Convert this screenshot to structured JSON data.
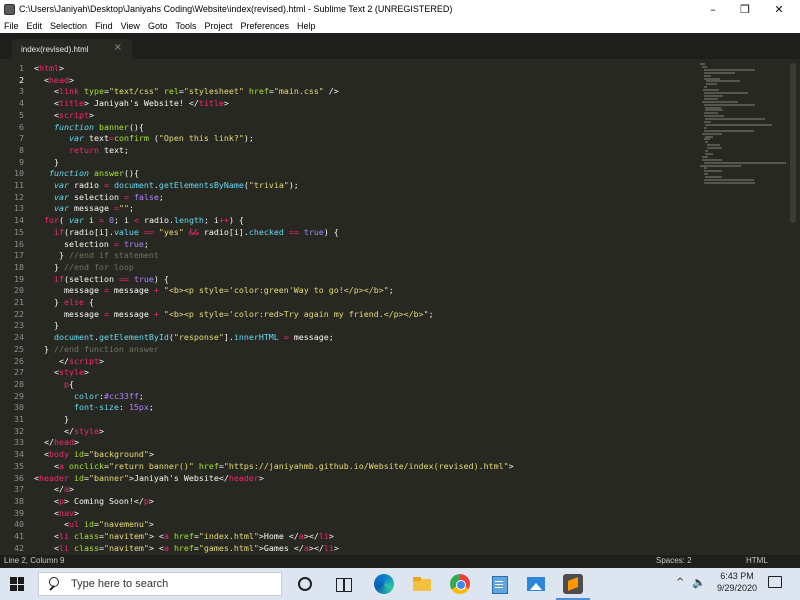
{
  "window": {
    "title": "C:\\Users\\Janiyah\\Desktop\\Janiyahs Coding\\Website\\index(revised).html - Sublime Text 2 (UNREGISTERED)",
    "minimize_glyph": "–",
    "maximize_glyph": "❐",
    "close_glyph": "✕"
  },
  "menu": [
    "File",
    "Edit",
    "Selection",
    "Find",
    "View",
    "Goto",
    "Tools",
    "Project",
    "Preferences",
    "Help"
  ],
  "tabs": [
    {
      "label": "index(revised).html",
      "close_glyph": "×"
    }
  ],
  "editor": {
    "active_line": 2,
    "line_numbers": [
      "1",
      "2",
      "3",
      "4",
      "5",
      "6",
      "7",
      "8",
      "9",
      "10",
      "11",
      "12",
      "13",
      "14",
      "15",
      "16",
      "17",
      "18",
      "19",
      "20",
      "21",
      "22",
      "23",
      "24",
      "25",
      "26",
      "27",
      "28",
      "29",
      "30",
      "31",
      "32",
      "33",
      "34",
      "35",
      "36",
      "37",
      "38",
      "39",
      "40",
      "41",
      "42"
    ],
    "lines": [
      [
        [
          "txt",
          "<"
        ],
        [
          "tag",
          "html"
        ],
        [
          "txt",
          ">"
        ]
      ],
      [
        [
          "txt",
          "  <"
        ],
        [
          "tag",
          "head"
        ],
        [
          "txt",
          ">"
        ]
      ],
      [
        [
          "txt",
          "    <"
        ],
        [
          "tag",
          "link"
        ],
        [
          "txt",
          " "
        ],
        [
          "attr",
          "type"
        ],
        [
          "txt",
          "="
        ],
        [
          "str",
          "\"text/css\""
        ],
        [
          "txt",
          " "
        ],
        [
          "attr",
          "rel"
        ],
        [
          "txt",
          "="
        ],
        [
          "str",
          "\"stylesheet\""
        ],
        [
          "txt",
          " "
        ],
        [
          "attr",
          "href"
        ],
        [
          "txt",
          "="
        ],
        [
          "str",
          "\"main.css\""
        ],
        [
          "txt",
          " />"
        ]
      ],
      [
        [
          "txt",
          "    <"
        ],
        [
          "tag",
          "title"
        ],
        [
          "txt",
          "> Janiyah's Website! </"
        ],
        [
          "tag",
          "title"
        ],
        [
          "txt",
          ">"
        ]
      ],
      [
        [
          "txt",
          "    <"
        ],
        [
          "tag",
          "script"
        ],
        [
          "txt",
          ">"
        ]
      ],
      [
        [
          "txt",
          "    "
        ],
        [
          "kw",
          "function"
        ],
        [
          "txt",
          " "
        ],
        [
          "fn",
          "banner"
        ],
        [
          "txt",
          "(){"
        ]
      ],
      [
        [
          "txt",
          "       "
        ],
        [
          "kw",
          "var"
        ],
        [
          "txt",
          " text"
        ],
        [
          "kwp",
          "="
        ],
        [
          "fn",
          "confirm"
        ],
        [
          "txt",
          " ("
        ],
        [
          "str",
          "\"Open this link?\""
        ],
        [
          "txt",
          ");"
        ]
      ],
      [
        [
          "txt",
          "       "
        ],
        [
          "kwp",
          "return"
        ],
        [
          "txt",
          " text;"
        ]
      ],
      [
        [
          "txt",
          "    }"
        ]
      ],
      [
        [
          "txt",
          "   "
        ],
        [
          "kw",
          "function"
        ],
        [
          "txt",
          " "
        ],
        [
          "fn",
          "answer"
        ],
        [
          "txt",
          "(){"
        ]
      ],
      [
        [
          "txt",
          "    "
        ],
        [
          "kw",
          "var"
        ],
        [
          "txt",
          " radio "
        ],
        [
          "kwp",
          "="
        ],
        [
          "txt",
          " "
        ],
        [
          "prop",
          "document"
        ],
        [
          "txt",
          "."
        ],
        [
          "prop",
          "getElementsByName"
        ],
        [
          "txt",
          "("
        ],
        [
          "str",
          "\"trivia\""
        ],
        [
          "txt",
          ");"
        ]
      ],
      [
        [
          "txt",
          "    "
        ],
        [
          "kw",
          "var"
        ],
        [
          "txt",
          " selection "
        ],
        [
          "kwp",
          "="
        ],
        [
          "txt",
          " "
        ],
        [
          "num",
          "false"
        ],
        [
          "txt",
          ";"
        ]
      ],
      [
        [
          "txt",
          "    "
        ],
        [
          "kw",
          "var"
        ],
        [
          "txt",
          " message "
        ],
        [
          "kwp",
          "="
        ],
        [
          "str",
          "\"\""
        ],
        [
          "txt",
          ";"
        ]
      ],
      [
        [
          "txt",
          "  "
        ],
        [
          "kwp",
          "for"
        ],
        [
          "txt",
          "( "
        ],
        [
          "kw",
          "var"
        ],
        [
          "txt",
          " i "
        ],
        [
          "kwp",
          "="
        ],
        [
          "txt",
          " "
        ],
        [
          "num",
          "0"
        ],
        [
          "txt",
          "; i "
        ],
        [
          "kwp",
          "<"
        ],
        [
          "txt",
          " radio."
        ],
        [
          "prop",
          "length"
        ],
        [
          "txt",
          "; i"
        ],
        [
          "kwp",
          "++"
        ],
        [
          "txt",
          ") {"
        ]
      ],
      [
        [
          "txt",
          "    "
        ],
        [
          "kwp",
          "if"
        ],
        [
          "txt",
          "(radio[i]."
        ],
        [
          "prop",
          "value"
        ],
        [
          "txt",
          " "
        ],
        [
          "kwp",
          "=="
        ],
        [
          "txt",
          " "
        ],
        [
          "str",
          "\"yes\""
        ],
        [
          "txt",
          " "
        ],
        [
          "kwp",
          "&&"
        ],
        [
          "txt",
          " radio[i]."
        ],
        [
          "prop",
          "checked"
        ],
        [
          "txt",
          " "
        ],
        [
          "kwp",
          "=="
        ],
        [
          "txt",
          " "
        ],
        [
          "num",
          "true"
        ],
        [
          "txt",
          ") {"
        ]
      ],
      [
        [
          "txt",
          "      selection "
        ],
        [
          "kwp",
          "="
        ],
        [
          "txt",
          " "
        ],
        [
          "num",
          "true"
        ],
        [
          "txt",
          ";"
        ]
      ],
      [
        [
          "txt",
          "     } "
        ],
        [
          "cm",
          "//end if statement"
        ]
      ],
      [
        [
          "txt",
          "    } "
        ],
        [
          "cm",
          "//end for loop"
        ]
      ],
      [
        [
          "txt",
          "    "
        ],
        [
          "kwp",
          "if"
        ],
        [
          "txt",
          "(selection "
        ],
        [
          "kwp",
          "=="
        ],
        [
          "txt",
          " "
        ],
        [
          "num",
          "true"
        ],
        [
          "txt",
          ") {"
        ]
      ],
      [
        [
          "txt",
          "      message "
        ],
        [
          "kwp",
          "="
        ],
        [
          "txt",
          " message "
        ],
        [
          "kwp",
          "+"
        ],
        [
          "txt",
          " "
        ],
        [
          "str",
          "\"<b><p style='color:green'Way to go!</p></b>\""
        ],
        [
          "txt",
          ";"
        ]
      ],
      [
        [
          "txt",
          "    } "
        ],
        [
          "kwp",
          "else"
        ],
        [
          "txt",
          " {"
        ]
      ],
      [
        [
          "txt",
          "      message "
        ],
        [
          "kwp",
          "="
        ],
        [
          "txt",
          " message "
        ],
        [
          "kwp",
          "+"
        ],
        [
          "txt",
          " "
        ],
        [
          "str",
          "\"<b><p style='color:red>Try again my friend.</p></b>\""
        ],
        [
          "txt",
          ";"
        ]
      ],
      [
        [
          "txt",
          "    }"
        ]
      ],
      [
        [
          "txt",
          "    "
        ],
        [
          "prop",
          "document"
        ],
        [
          "txt",
          "."
        ],
        [
          "prop",
          "getElementById"
        ],
        [
          "txt",
          "("
        ],
        [
          "str",
          "\"response\""
        ],
        [
          "txt",
          "]."
        ],
        [
          "prop",
          "innerHTML"
        ],
        [
          "txt",
          " "
        ],
        [
          "kwp",
          "="
        ],
        [
          "txt",
          " message;"
        ]
      ],
      [
        [
          "txt",
          "  } "
        ],
        [
          "cm",
          "//end function answer"
        ]
      ],
      [
        [
          "txt",
          "     </"
        ],
        [
          "tag",
          "script"
        ],
        [
          "txt",
          ">"
        ]
      ],
      [
        [
          "txt",
          "    <"
        ],
        [
          "tag",
          "style"
        ],
        [
          "txt",
          ">"
        ]
      ],
      [
        [
          "txt",
          "      "
        ],
        [
          "tag",
          "p"
        ],
        [
          "txt",
          "{"
        ]
      ],
      [
        [
          "txt",
          "        "
        ],
        [
          "prop",
          "color"
        ],
        [
          "txt",
          ":"
        ],
        [
          "num",
          "#cc33ff"
        ],
        [
          "txt",
          ";"
        ]
      ],
      [
        [
          "txt",
          "        "
        ],
        [
          "prop",
          "font-size"
        ],
        [
          "txt",
          ": "
        ],
        [
          "num",
          "15px"
        ],
        [
          "txt",
          ";"
        ]
      ],
      [
        [
          "txt",
          "      }"
        ]
      ],
      [
        [
          "txt",
          "      </"
        ],
        [
          "tag",
          "style"
        ],
        [
          "txt",
          ">"
        ]
      ],
      [
        [
          "txt",
          "  </"
        ],
        [
          "tag",
          "head"
        ],
        [
          "txt",
          ">"
        ]
      ],
      [
        [
          "txt",
          "  <"
        ],
        [
          "tag",
          "body"
        ],
        [
          "txt",
          " "
        ],
        [
          "attr",
          "id"
        ],
        [
          "txt",
          "="
        ],
        [
          "str",
          "\"background\""
        ],
        [
          "txt",
          ">"
        ]
      ],
      [
        [
          "txt",
          "    <"
        ],
        [
          "tag",
          "a"
        ],
        [
          "txt",
          " "
        ],
        [
          "attr",
          "onclick"
        ],
        [
          "txt",
          "="
        ],
        [
          "str",
          "\"return banner()\""
        ],
        [
          "txt",
          " "
        ],
        [
          "attr",
          "href"
        ],
        [
          "txt",
          "="
        ],
        [
          "str",
          "\"https://janiyahmb.github.io/Website/index(revised).html\""
        ],
        [
          "txt",
          ">"
        ]
      ],
      [
        [
          "txt",
          "<"
        ],
        [
          "tag",
          "header"
        ],
        [
          "txt",
          " "
        ],
        [
          "attr",
          "id"
        ],
        [
          "txt",
          "="
        ],
        [
          "str",
          "\"banner\""
        ],
        [
          "txt",
          ">Janiyah's Website</"
        ],
        [
          "tag",
          "header"
        ],
        [
          "txt",
          ">"
        ]
      ],
      [
        [
          "txt",
          "    </"
        ],
        [
          "tag",
          "a"
        ],
        [
          "txt",
          ">"
        ]
      ],
      [
        [
          "txt",
          "    <"
        ],
        [
          "tag",
          "p"
        ],
        [
          "txt",
          "> Coming Soon!</"
        ],
        [
          "tag",
          "p"
        ],
        [
          "txt",
          ">"
        ]
      ],
      [
        [
          "txt",
          "    <"
        ],
        [
          "tag",
          "nav"
        ],
        [
          "txt",
          ">"
        ]
      ],
      [
        [
          "txt",
          "      <"
        ],
        [
          "tag",
          "ul"
        ],
        [
          "txt",
          " "
        ],
        [
          "attr",
          "id"
        ],
        [
          "txt",
          "="
        ],
        [
          "str",
          "\"navemenu\""
        ],
        [
          "txt",
          ">"
        ]
      ],
      [
        [
          "txt",
          "    <"
        ],
        [
          "tag",
          "li"
        ],
        [
          "txt",
          " "
        ],
        [
          "attr",
          "class"
        ],
        [
          "txt",
          "="
        ],
        [
          "str",
          "\"navitem\""
        ],
        [
          "txt",
          "> <"
        ],
        [
          "tag",
          "a"
        ],
        [
          "txt",
          " "
        ],
        [
          "attr",
          "href"
        ],
        [
          "txt",
          "="
        ],
        [
          "str",
          "\"index.html\""
        ],
        [
          "txt",
          ">Home </"
        ],
        [
          "tag",
          "a"
        ],
        [
          "txt",
          "></"
        ],
        [
          "tag",
          "li"
        ],
        [
          "txt",
          ">"
        ]
      ],
      [
        [
          "txt",
          "    <"
        ],
        [
          "tag",
          "li"
        ],
        [
          "txt",
          " "
        ],
        [
          "attr",
          "class"
        ],
        [
          "txt",
          "="
        ],
        [
          "str",
          "\"navitem\""
        ],
        [
          "txt",
          "> <"
        ],
        [
          "tag",
          "a"
        ],
        [
          "txt",
          " "
        ],
        [
          "attr",
          "href"
        ],
        [
          "txt",
          "="
        ],
        [
          "str",
          "\"games.html\""
        ],
        [
          "txt",
          ">Games </"
        ],
        [
          "tag",
          "a"
        ],
        [
          "txt",
          "></"
        ],
        [
          "tag",
          "li"
        ],
        [
          "txt",
          ">"
        ]
      ]
    ]
  },
  "status": {
    "position": "Line 2, Column 9",
    "spaces": "Spaces: 2",
    "syntax": "HTML"
  },
  "taskbar": {
    "search_placeholder": "Type here to search",
    "apps": [
      "cortana-icon",
      "task-view-icon",
      "edge-icon",
      "file-explorer-icon",
      "chrome-icon",
      "notepad-icon",
      "photos-icon",
      "sublime-text-icon"
    ],
    "tray_up_glyph": "^",
    "volume_glyph": "🔈",
    "time": "6:43 PM",
    "date": "9/29/2020"
  },
  "colors": {
    "editor_bg": "#272822",
    "tag": "#f92672",
    "attr": "#a6e22e",
    "string": "#e6db74",
    "keyword": "#66d9ef",
    "comment": "#75715e",
    "number": "#ae81ff"
  }
}
